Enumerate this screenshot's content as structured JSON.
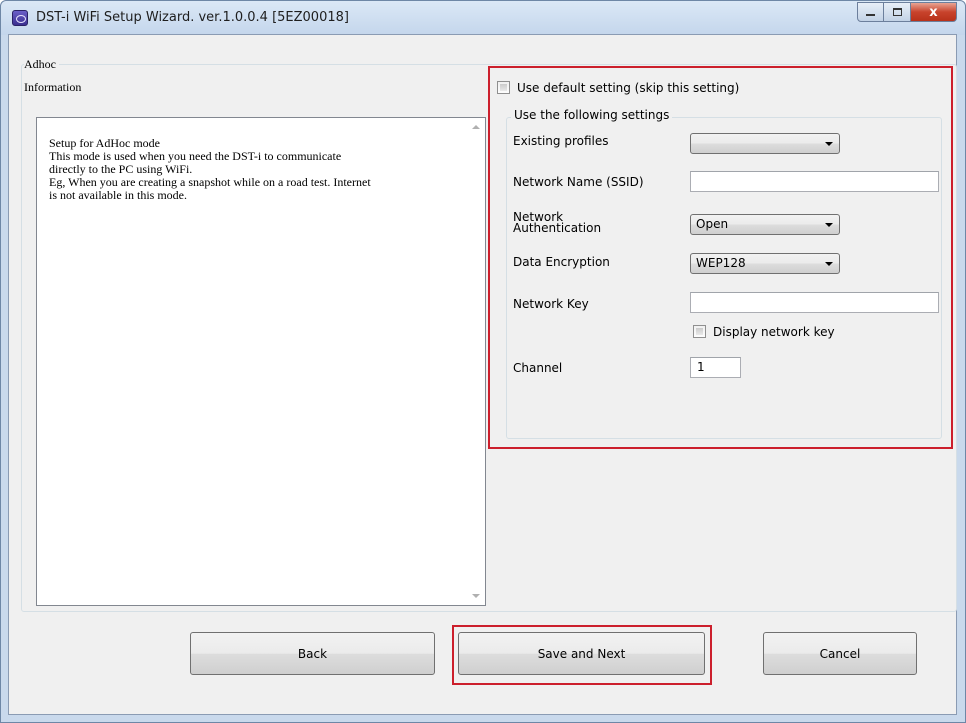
{
  "window": {
    "title": "DST-i WiFi Setup Wizard. ver.1.0.0.4 [5EZ00018]",
    "close_glyph": "x"
  },
  "group": {
    "title": "Adhoc",
    "info_label": "Information",
    "info_lines": [
      "Setup for AdHoc mode",
      "This mode is used when you need the DST-i to communicate",
      "directly to the PC using WiFi.",
      "Eg, When you are creating a snapshot while on a road test. Internet",
      "is not available in this mode."
    ]
  },
  "settings": {
    "default_checkbox_label": "Use default setting (skip this setting)",
    "group_title": "Use the following settings",
    "existing_profiles_label": "Existing profiles",
    "existing_profiles_value": "",
    "network_name_label": "Network Name (SSID)",
    "network_name_value": "",
    "auth_label_line1": "Network",
    "auth_label_line2": "Authentication",
    "auth_value": "Open",
    "encryption_label": "Data Encryption",
    "encryption_value": "WEP128",
    "network_key_label": "Network Key",
    "network_key_value": "",
    "display_key_label": "Display network key",
    "channel_label": "Channel",
    "channel_value": "1"
  },
  "buttons": {
    "back": "Back",
    "save_next": "Save and Next",
    "cancel": "Cancel"
  },
  "colors": {
    "highlight_border": "#cc1f2c",
    "titlebar": "#c4d6ec",
    "close_button": "#c8432c"
  }
}
